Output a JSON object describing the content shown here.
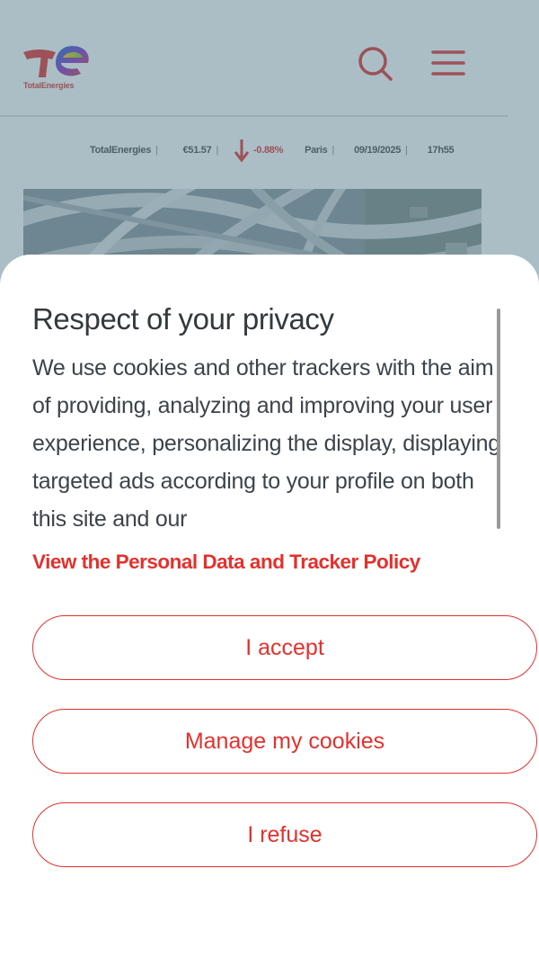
{
  "header": {
    "logo_wordmark": "TotalEnergies"
  },
  "ticker": {
    "company": "TotalEnergies",
    "price": "€51.57",
    "change": "-0.88%",
    "city": "Paris",
    "date": "09/19/2025",
    "time": "17h55",
    "separator": "|"
  },
  "consent": {
    "title": "Respect of your privacy",
    "body": "We use cookies and other trackers with the aim of providing, analyzing and improving your user experience, personalizing the display, displaying targeted ads according to your profile on both this site and our",
    "policy_link": "View the Personal Data and Tracker Policy",
    "buttons": {
      "accept": "I accept",
      "manage": "Manage my cookies",
      "refuse": "I refuse"
    }
  },
  "colors": {
    "brand_red": "#e3312d",
    "overlay": "rgba(80,120,135,0.48)",
    "text_dark": "#333a3f"
  },
  "icons": {
    "search": "search-icon",
    "menu": "hamburger-menu-icon",
    "stock_down": "arrow-down-icon"
  }
}
